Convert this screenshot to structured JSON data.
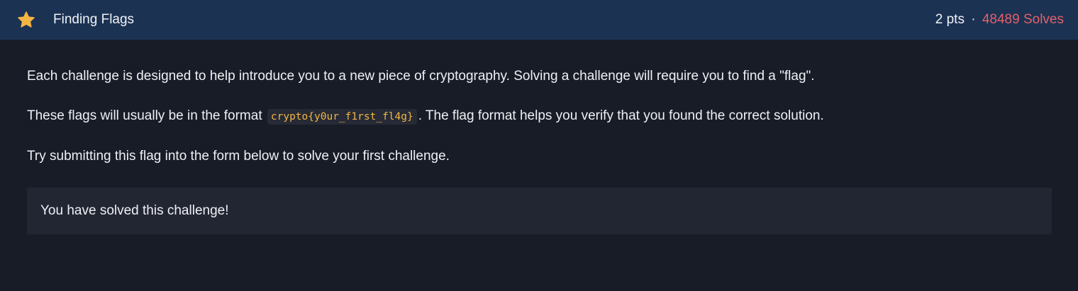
{
  "header": {
    "title": "Finding Flags",
    "points": "2 pts",
    "separator": "·",
    "solves": "48489 Solves",
    "star_icon": "star-icon",
    "star_color": "#f4b544"
  },
  "description": {
    "para1": "Each challenge is designed to help introduce you to a new piece of cryptography. Solving a challenge will require you to find a \"flag\".",
    "para2_before": "These flags will usually be in the format",
    "para2_code": "crypto{y0ur_f1rst_fl4g}",
    "para2_after": ". The flag format helps you verify that you found the correct solution.",
    "para3": "Try submitting this flag into the form below to solve your first challenge."
  },
  "status": {
    "message": "You have solved this challenge!"
  },
  "colors": {
    "header_bg": "#1b3253",
    "page_bg": "#181c27",
    "solves_text": "#e36169",
    "code_text": "#f2b640",
    "panel_bg": "#222633"
  }
}
